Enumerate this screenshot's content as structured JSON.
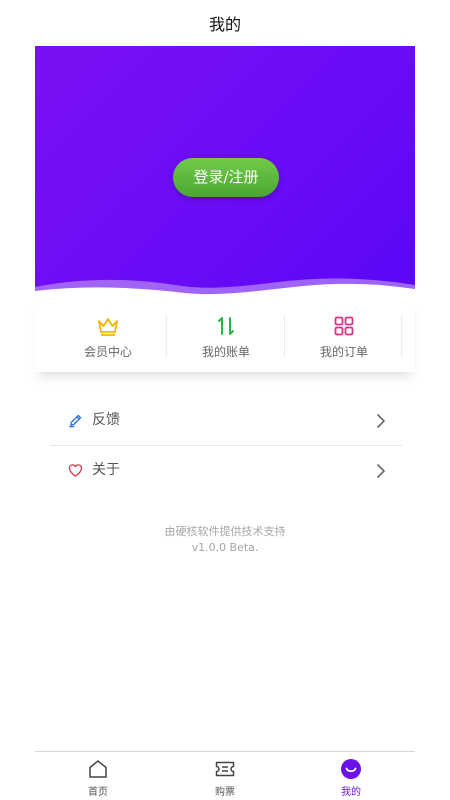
{
  "header": {
    "title": "我的"
  },
  "hero": {
    "login_label": "登录/注册"
  },
  "quick_actions": [
    {
      "label": "会员中心",
      "icon": "crown-icon",
      "color": "#f2b705"
    },
    {
      "label": "我的账单",
      "icon": "sort-arrows-icon",
      "color": "#2bb34b"
    },
    {
      "label": "我的订单",
      "icon": "grid-icon",
      "color": "#d63384"
    }
  ],
  "menu": [
    {
      "label": "反馈",
      "icon": "pencil-icon",
      "color": "#2d6bd6"
    },
    {
      "label": "关于",
      "icon": "heart-icon",
      "color": "#d9364a"
    }
  ],
  "footer": {
    "support_text": "由硬核软件提供技术支持",
    "version": "v1.0.0 Beta."
  },
  "tabbar": {
    "active": "我的",
    "accent": "#6a12e8",
    "items": [
      {
        "label": "首页",
        "icon": "home-icon"
      },
      {
        "label": "购票",
        "icon": "ticket-icon"
      },
      {
        "label": "我的",
        "icon": "smile-icon"
      }
    ]
  }
}
